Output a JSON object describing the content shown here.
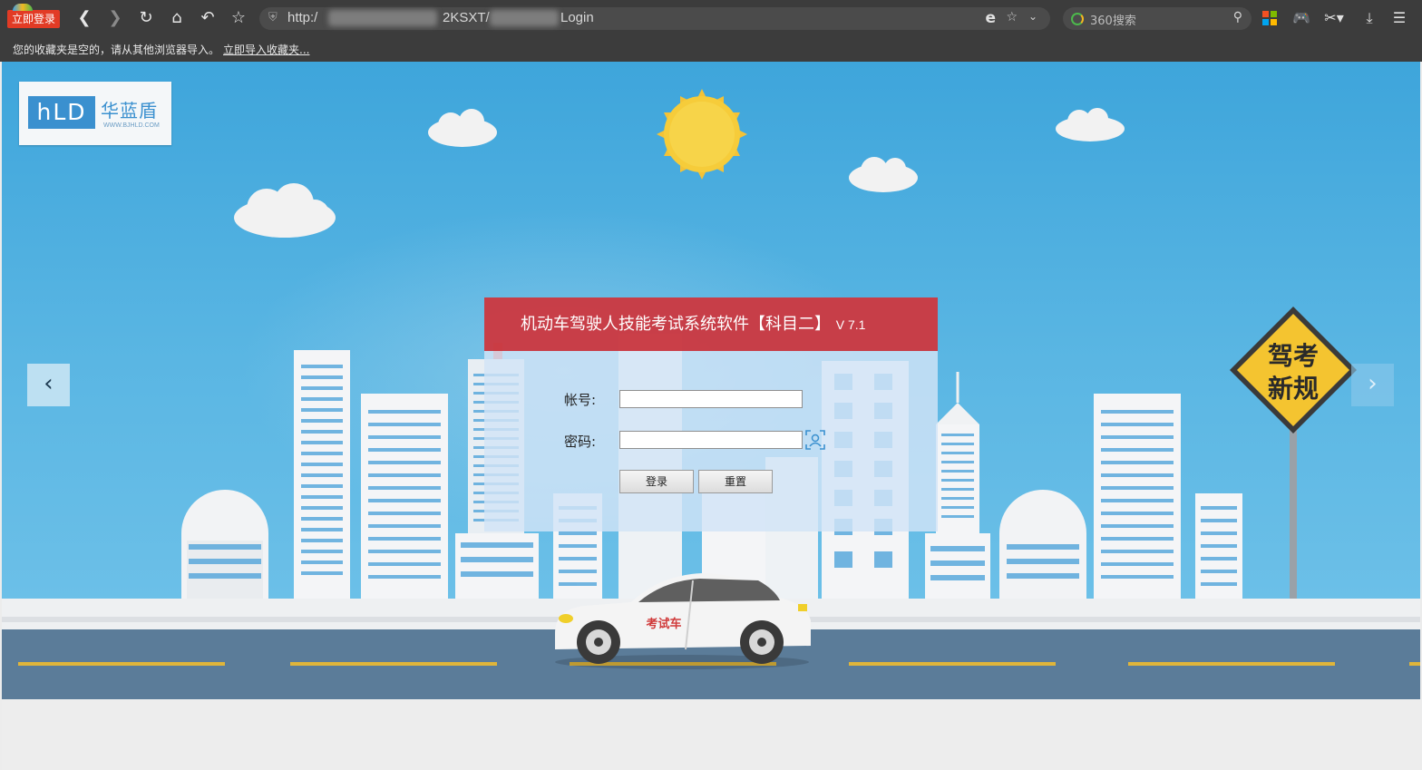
{
  "browser": {
    "login_badge": "立即登录",
    "url_prefix": "http:/",
    "url_mid": "2KSXT/",
    "url_tail": "Login",
    "search_placeholder": "360搜索",
    "favorites_notice": "您的收藏夹是空的，请从其他浏览器导入。",
    "favorites_import_link": "立即导入收藏夹..."
  },
  "brand": {
    "mark": "hLD",
    "name": "华蓝盾",
    "url": "WWW.BJHLD.COM"
  },
  "login": {
    "title": "机动车驾驶人技能考试系统软件【科目二】",
    "version": "V 7.1",
    "account_label": "帐号:",
    "account_value": "",
    "password_label": "密码:",
    "password_value": "",
    "login_button": "登录",
    "reset_button": "重置"
  },
  "scene": {
    "sign_line1": "驾考",
    "sign_line2": "新规",
    "car_label": "考试车"
  },
  "colors": {
    "sky": "#4aacdf",
    "header_red": "#c8282f",
    "road": "#5a7a98",
    "lane_yellow": "#e0b53a"
  }
}
